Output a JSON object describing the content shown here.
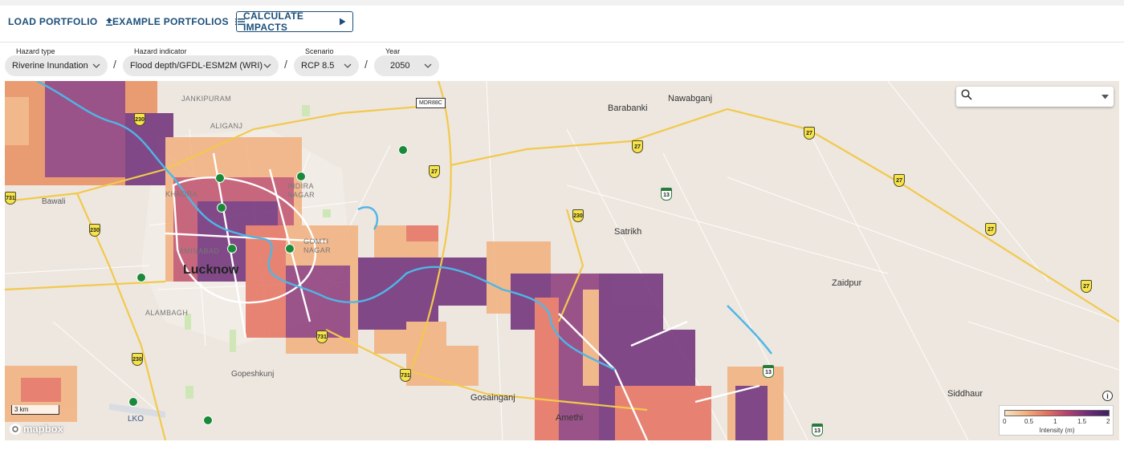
{
  "toolbar": {
    "load_portfolio": "LOAD PORTFOLIO",
    "example_portfolios": "EXAMPLE PORTFOLIOS",
    "calculate_impacts": "CALCULATE IMPACTS"
  },
  "filters": {
    "hazard_type": {
      "label": "Hazard type",
      "value": "Riverine Inundation"
    },
    "hazard_indicator": {
      "label": "Hazard indicator",
      "value": "Flood depth/GFDL-ESM2M (WRI)"
    },
    "scenario": {
      "label": "Scenario",
      "value": "RCP 8.5"
    },
    "year": {
      "label": "Year",
      "value": "2050"
    },
    "separator": "/"
  },
  "map": {
    "places": {
      "jankipuram": "JANKIPURAM",
      "aliganj": "ALIGANJ",
      "indira_nagar_1": "INDIRA",
      "indira_nagar_2": "NAGAR",
      "khadra": "KHADRA",
      "bawali": "Bawali",
      "aminabad": "AMINABAD",
      "gomti_nagar_1": "GOMTI",
      "gomti_nagar_2": "NAGAR",
      "lucknow": "Lucknow",
      "alambagh": "ALAMBAGH",
      "gopeshkunj": "Gopeshkunj",
      "lko": "LKO",
      "barabanki": "Barabanki",
      "nawabganj": "Nawabganj",
      "satrikh": "Satrikh",
      "zaidpur": "Zaidpur",
      "gosainganj": "Gosainganj",
      "amethi": "Amethi",
      "siddhaur": "Siddhaur"
    },
    "road_shields": {
      "mdr": "MDR88C",
      "nh230_a": "230",
      "nh230_b": "230",
      "nh230_c": "230",
      "nh230_d": "230",
      "nh731_a": "731",
      "nh731_b": "731",
      "nh731_c": "731",
      "nh27_a": "27",
      "nh27_b": "27",
      "nh27_c": "27",
      "nh27_d": "27",
      "nh27_e": "27",
      "nh27_f": "27",
      "nh13_a": "13",
      "nh13_b": "13",
      "nh13_c": "13"
    },
    "search_placeholder": "",
    "scale_label": "3 km",
    "attribution": "mapbox",
    "info_symbol": "i"
  },
  "legend": {
    "title": "Intensity (m)",
    "ticks": [
      "0",
      "0.5",
      "1",
      "1.5",
      "2"
    ],
    "colors": [
      "#f6e3c6",
      "#f2b07e",
      "#e6715f",
      "#b6406f",
      "#6e2d78",
      "#3e1f63"
    ]
  },
  "colors": {
    "accent": "#1b4f7a",
    "portfolio_marker": "#1a8a3a",
    "river": "#4fb6e6",
    "highway": "#f2c94c"
  }
}
